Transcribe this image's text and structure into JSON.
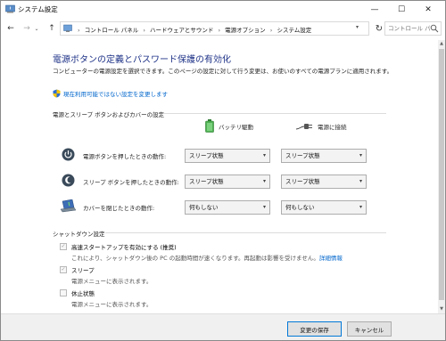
{
  "window": {
    "title": "システム設定",
    "controls": {
      "minimize": "—",
      "maximize": "☐",
      "close": "✕"
    }
  },
  "nav": {
    "back": "←",
    "forward": "→",
    "recent": "⌄",
    "up": "↑",
    "breadcrumbs": [
      "コントロール パネル",
      "ハードウェアとサウンド",
      "電源オプション",
      "システム設定"
    ],
    "separator": "›",
    "refresh": "↻",
    "search_placeholder": "コントロール パ..."
  },
  "main": {
    "heading": "電源ボタンの定義とパスワード保護の有効化",
    "description": "コンピューターの電源設定を選択できます。このページの設定に対して行う変更は、お使いのすべての電源プランに適用されます。",
    "change_link": "現在利用可能ではない設定を変更します",
    "buttons_section": {
      "title": "電源とスリープ ボタンおよびカバーの設定",
      "col_battery": "バッテリ駆動",
      "col_plugged": "電源に接続",
      "rows": [
        {
          "label": "電源ボタンを押したときの動作:",
          "battery": "スリープ状態",
          "plugged": "スリープ状態",
          "icon": "power-icon"
        },
        {
          "label": "スリープ ボタンを押したときの動作:",
          "battery": "スリープ状態",
          "plugged": "スリープ状態",
          "icon": "moon-icon"
        },
        {
          "label": "カバーを閉じたときの動作:",
          "battery": "何もしない",
          "plugged": "何もしない",
          "icon": "laptop-icon"
        }
      ]
    },
    "shutdown_section": {
      "title": "シャットダウン設定",
      "items": [
        {
          "label": "高速スタートアップを有効にする (推奨)",
          "checked": true,
          "sub": "これにより、シャットダウン後の PC の起動時間が速くなります。再起動は影響を受けません。",
          "link": "詳細情報"
        },
        {
          "label": "スリープ",
          "checked": true,
          "sub": "電源メニューに表示されます。"
        },
        {
          "label": "休止状態",
          "checked": false,
          "sub": "電源メニューに表示されます。"
        }
      ]
    }
  },
  "footer": {
    "save": "変更の保存",
    "cancel": "キャンセル"
  },
  "colors": {
    "heading": "#1e3287",
    "link": "#0066cc",
    "footer_bg": "#f0f0f0"
  }
}
